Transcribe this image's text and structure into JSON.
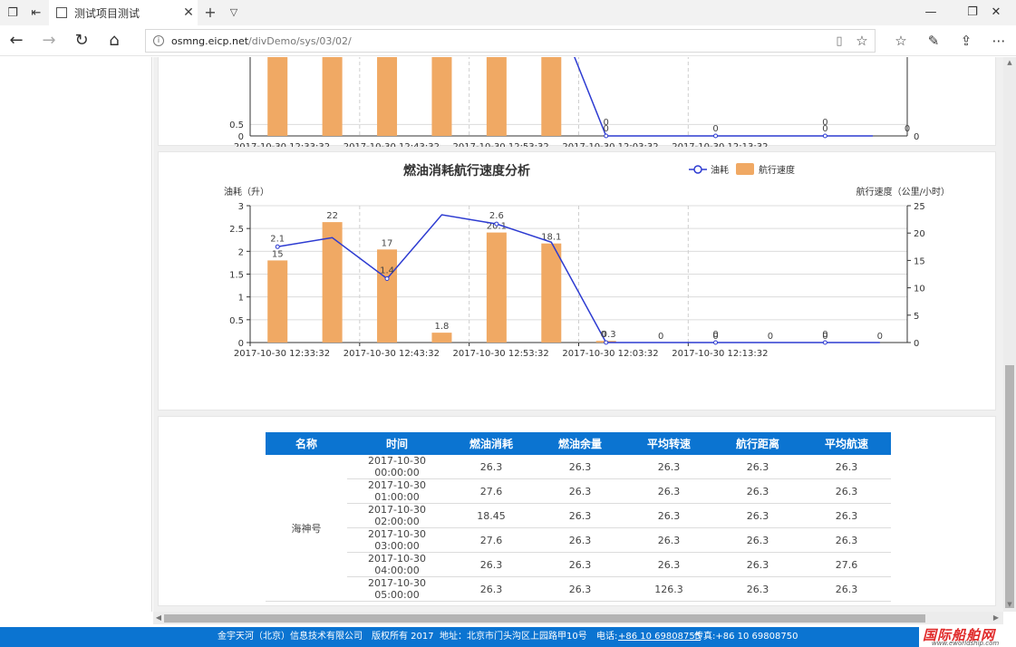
{
  "browser": {
    "tab_title": "测试项目测试",
    "url_host": "osmng.eicp.net",
    "url_path": "/divDemo/sys/03/02/"
  },
  "top_chart": {
    "y_left_ticks": [
      "0.5",
      "0"
    ],
    "y_right_ticks": [
      "0"
    ],
    "x_tick_labels": [
      "2017-10-30 12:33:32",
      "2017-10-30 12:43:32",
      "2017-10-30 12:53:32",
      "2017-10-30 12:03:32",
      "2017-10-30 12:13:32"
    ],
    "point_labels": [
      "0",
      "0",
      "0",
      "0",
      "0",
      "0"
    ]
  },
  "chart_data": {
    "type": "bar",
    "title": "燃油消耗航行速度分析",
    "legend_position": "top-right",
    "ylabel_left": "油耗（升）",
    "ylabel_right": "航行速度（公里/小时）",
    "ylim_left": [
      0,
      3
    ],
    "ylim_right": [
      0,
      25
    ],
    "y_left_ticks": [
      "3",
      "2.5",
      "2",
      "1.5",
      "1",
      "0.5",
      "0"
    ],
    "y_right_ticks": [
      "25",
      "20",
      "15",
      "10",
      "5",
      "0"
    ],
    "x_tick_labels": [
      "2017-10-30 12:33:32",
      "2017-10-30 12:43:32",
      "2017-10-30 12:53:32",
      "2017-10-30 12:03:32",
      "2017-10-30 12:13:32"
    ],
    "grid": true,
    "series": [
      {
        "name": "油耗",
        "type": "line",
        "axis": "left",
        "color": "#2d3bd1",
        "values": [
          2.1,
          2.3,
          1.4,
          2.8,
          2.6,
          2.2,
          0,
          0,
          0,
          0,
          0,
          0
        ],
        "labels": [
          "2.1",
          "",
          "1.4",
          "",
          "2.6",
          "",
          "0",
          "",
          "0",
          "",
          "0",
          ""
        ]
      },
      {
        "name": "航行速度",
        "type": "bar",
        "axis": "right",
        "color": "#f0a964",
        "values": [
          15,
          22,
          17,
          1.8,
          20.1,
          18.1,
          0.3,
          0,
          0,
          0,
          0,
          0
        ],
        "labels": [
          "15",
          "22",
          "17",
          "1.8",
          "20.1",
          "18.1",
          "0.3",
          "0",
          "0",
          "0",
          "0",
          "0"
        ]
      }
    ]
  },
  "table": {
    "headers": [
      "名称",
      "时间",
      "燃油消耗",
      "燃油余量",
      "平均转速",
      "航行距离",
      "平均航速"
    ],
    "ship_name": "海神号",
    "rows": [
      [
        "2017-10-30 00:00:00",
        "26.3",
        "26.3",
        "26.3",
        "26.3",
        "26.3"
      ],
      [
        "2017-10-30 01:00:00",
        "27.6",
        "26.3",
        "26.3",
        "26.3",
        "26.3"
      ],
      [
        "2017-10-30 02:00:00",
        "18.45",
        "26.3",
        "26.3",
        "26.3",
        "26.3"
      ],
      [
        "2017-10-30 03:00:00",
        "27.6",
        "26.3",
        "26.3",
        "26.3",
        "26.3"
      ],
      [
        "2017-10-30 04:00:00",
        "26.3",
        "26.3",
        "26.3",
        "26.3",
        "27.6"
      ],
      [
        "2017-10-30 05:00:00",
        "26.3",
        "26.3",
        "126.3",
        "26.3",
        "26.3"
      ]
    ]
  },
  "footer": {
    "company": "金宇天河（北京）信息技术有限公司",
    "copyright": "版权所有 2017",
    "address": "地址：北京市门头沟区上园路甲10号",
    "tel_label": "电话:",
    "tel": "+86 10 69808755",
    "fax": "传真:+86 10 69808750"
  },
  "watermark": {
    "brand": "国际船舶网",
    "site": "www.eworldship.com"
  }
}
